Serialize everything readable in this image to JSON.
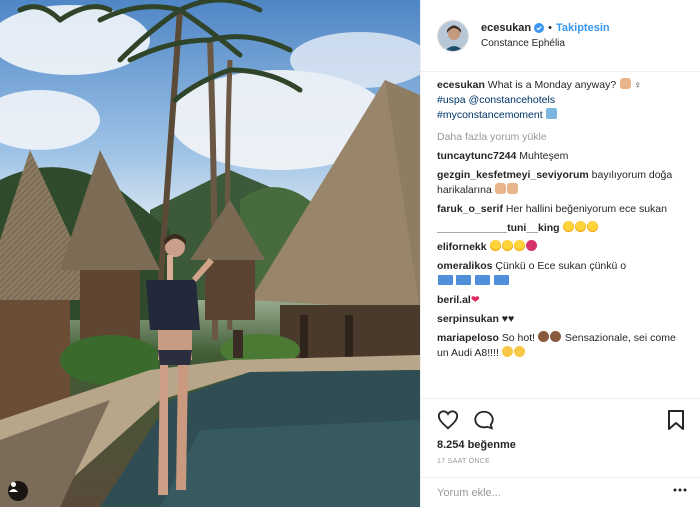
{
  "post": {
    "username": "ecesukan",
    "follow_label": "Takiptesin",
    "location": "Constance Ephélia",
    "caption_text": "What is a Monday anyway?",
    "hashtags": [
      "#uspa",
      "@constancehotels",
      "#myconstancemoment"
    ],
    "load_more_label": "Daha fazla yorum yükle",
    "likes": "8.254 beğenme",
    "timestamp": "17 SAAT ÖNCE",
    "comment_placeholder": "Yorum ekle..."
  },
  "comments": [
    {
      "user": "tuncaytunc7244",
      "text": "Muhteşem"
    },
    {
      "user": "gezgin_kesfetmeyi_seviyorum",
      "text": "bayılıyorum doğa harikalarına"
    },
    {
      "user": "faruk_o_serif",
      "text": "Her hallini beğeniyorum ece sukan"
    },
    {
      "user": "____________tuni__king",
      "text": ""
    },
    {
      "user": "elifornekk",
      "text": ""
    },
    {
      "user": "omeralikos",
      "text": "Çünkü o Ece sukan çünkü o"
    },
    {
      "user": "beril.al",
      "text": ""
    },
    {
      "user": "serpinsukan",
      "text": "♥♥"
    },
    {
      "user": "mariapeloso",
      "text": "So hot!",
      "text2": "Sensazionale, sei come un Audi A8!!!!"
    }
  ],
  "icons": {
    "verified": "verified-badge-icon",
    "like": "heart-outline-icon",
    "comment": "comment-bubble-icon",
    "save": "bookmark-icon",
    "more": "more-options-icon",
    "photo_tag": "user-tag-icon"
  },
  "colors": {
    "link": "#003569",
    "follow": "#3897f0",
    "muted": "#999999",
    "text": "#262626"
  }
}
